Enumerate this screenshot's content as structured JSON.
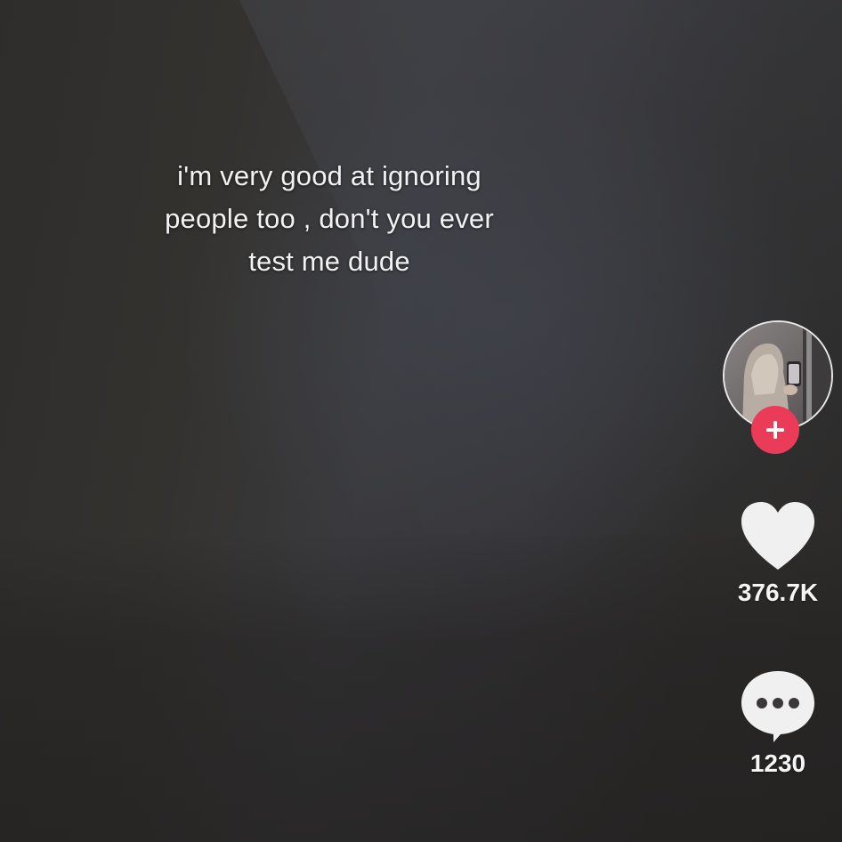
{
  "caption": {
    "line1": "i'm very good at ignoring",
    "line2": "people too , don't you ever",
    "line3": "test me dude"
  },
  "sidebar": {
    "avatar_icon": "creator-avatar",
    "follow_icon": "plus-icon",
    "like": {
      "icon": "heart-icon",
      "count": "376.7K"
    },
    "comment": {
      "icon": "comment-bubble-icon",
      "count": "1230"
    }
  },
  "colors": {
    "follow_button": "#ea3b58",
    "icon_fill": "#f0f0f0",
    "background": "#2e2c2b"
  }
}
